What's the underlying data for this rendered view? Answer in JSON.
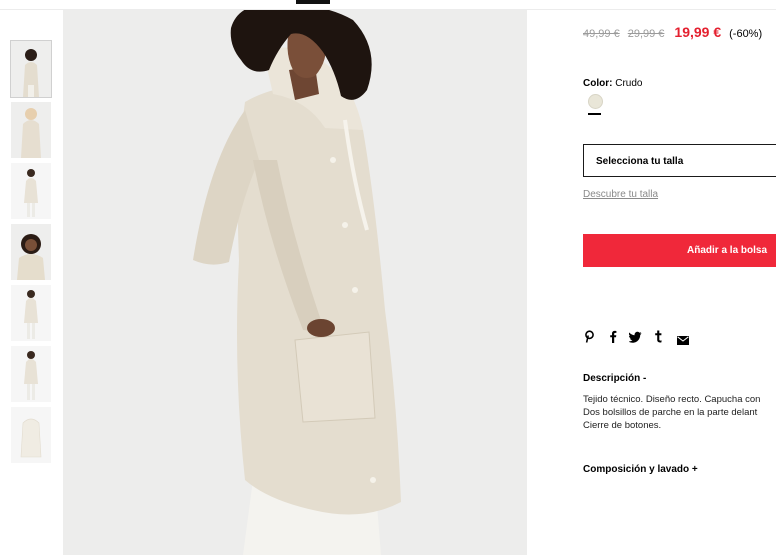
{
  "product": {
    "prices": {
      "original": "49,99 €",
      "previous": "29,99 €",
      "current": "19,99 €",
      "discount": "(-60%)"
    },
    "color": {
      "label": "Color:",
      "value": "Crudo",
      "swatch_hex": "#e9e6d8"
    },
    "size_select": {
      "placeholder": "Selecciona tu talla"
    },
    "size_guide_link": "Descubre tu talla",
    "add_to_bag_label": "Añadir a la bolsa",
    "social_icons": [
      "pinterest-icon",
      "facebook-icon",
      "twitter-icon",
      "tumblr-icon",
      "mail-icon"
    ],
    "description": {
      "title": "Descripción -",
      "lines": [
        "Tejido técnico. Diseño recto. Capucha con",
        "Dos bolsillos de parche en la parte delant",
        "Cierre de botones."
      ]
    },
    "composition_title": "Composición y lavado +"
  },
  "gallery": {
    "thumbnail_count": 7,
    "active_thumbnail": 1
  },
  "colors": {
    "accent_red": "#f0283a",
    "price_red": "#e4202f",
    "strikethrough_gray": "#9a9a9a"
  }
}
